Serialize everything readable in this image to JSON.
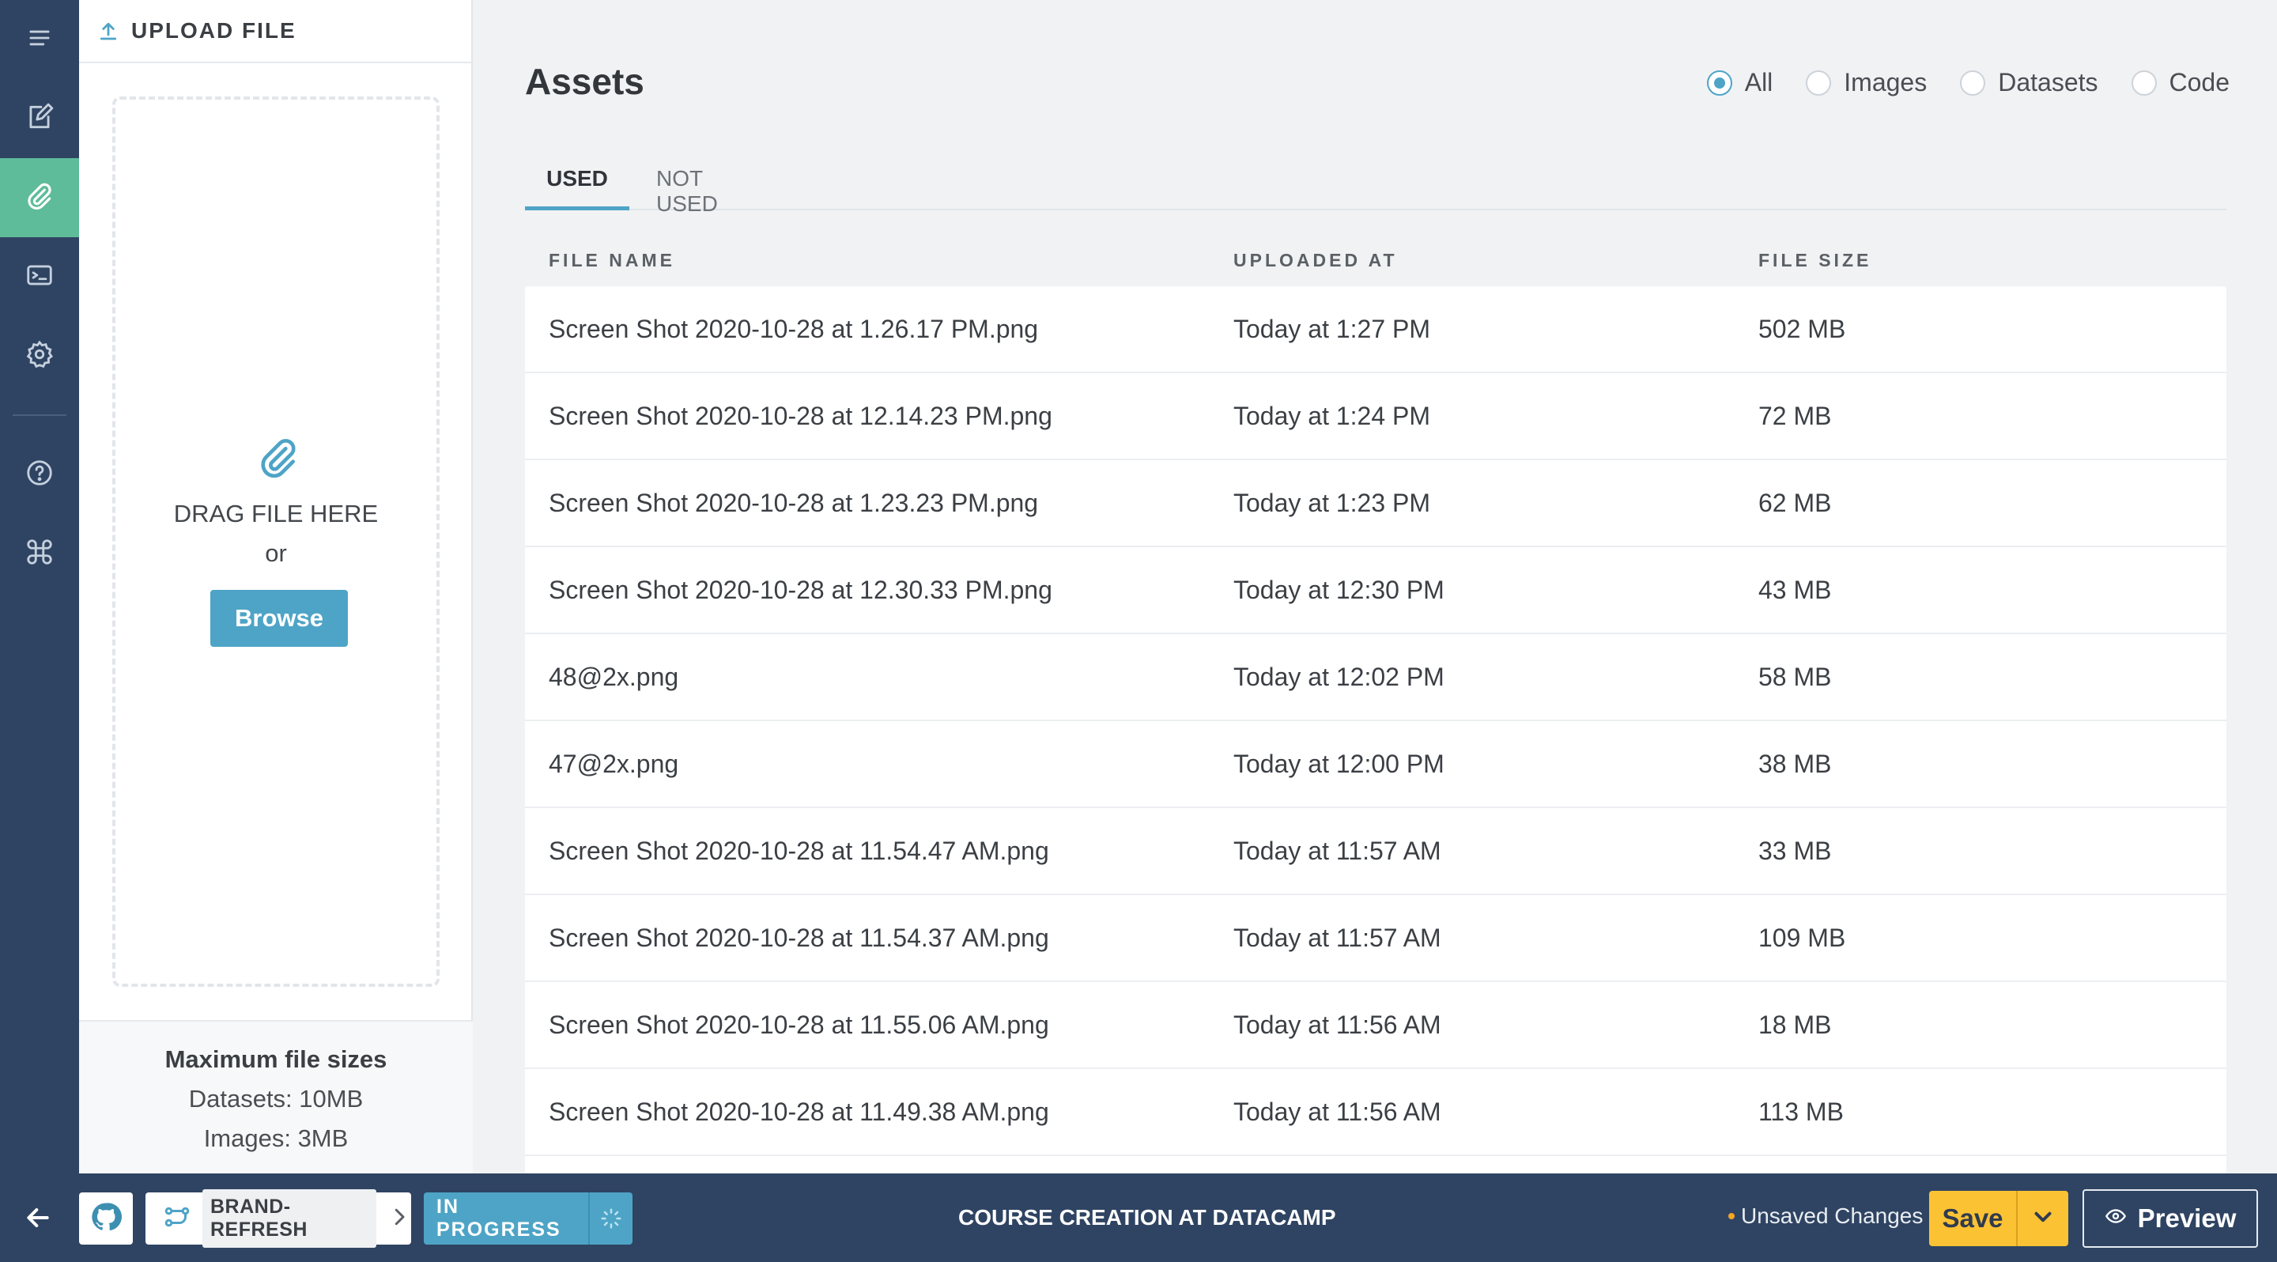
{
  "rail": {
    "items": [
      "menu-icon",
      "edit-icon",
      "paperclip-icon",
      "console-icon",
      "gear-icon",
      "help-icon",
      "command-icon"
    ],
    "active": "paperclip-icon"
  },
  "upload": {
    "title": "UPLOAD FILE",
    "drag_text": "DRAG FILE HERE",
    "or_text": "or",
    "browse_label": "Browse",
    "limits_title": "Maximum file sizes",
    "limit_datasets": "Datasets: 10MB",
    "limit_images": "Images: 3MB"
  },
  "main": {
    "title": "Assets",
    "filters": [
      {
        "label": "All",
        "checked": true
      },
      {
        "label": "Images",
        "checked": false
      },
      {
        "label": "Datasets",
        "checked": false
      },
      {
        "label": "Code",
        "checked": false
      }
    ],
    "tabs": [
      {
        "label": "USED",
        "active": true
      },
      {
        "label": "NOT USED",
        "active": false
      }
    ],
    "columns": [
      "FILE NAME",
      "UPLOADED AT",
      "FILE SIZE"
    ],
    "rows": [
      [
        "Screen Shot 2020-10-28 at 1.26.17 PM.png",
        "Today at 1:27 PM",
        "502 MB"
      ],
      [
        "Screen Shot 2020-10-28 at 12.14.23 PM.png",
        "Today at 1:24 PM",
        "72 MB"
      ],
      [
        "Screen Shot 2020-10-28 at 1.23.23 PM.png",
        "Today at 1:23 PM",
        "62 MB"
      ],
      [
        "Screen Shot 2020-10-28 at 12.30.33 PM.png",
        "Today at 12:30 PM",
        "43 MB"
      ],
      [
        "48@2x.png",
        "Today at 12:02 PM",
        "58 MB"
      ],
      [
        "47@2x.png",
        "Today at 12:00 PM",
        "38 MB"
      ],
      [
        "Screen Shot 2020-10-28 at 11.54.47 AM.png",
        "Today at 11:57 AM",
        "33 MB"
      ],
      [
        "Screen Shot 2020-10-28 at 11.54.37 AM.png",
        "Today at 11:57 AM",
        "109 MB"
      ],
      [
        "Screen Shot 2020-10-28 at 11.55.06 AM.png",
        "Today at 11:56 AM",
        "18 MB"
      ],
      [
        "Screen Shot 2020-10-28 at 11.49.38 AM.png",
        "Today at 11:56 AM",
        "113 MB"
      ]
    ]
  },
  "bottombar": {
    "branch": "BRAND-REFRESH",
    "status": "IN PROGRESS",
    "course_title": "COURSE CREATION AT DATACAMP",
    "unsaved": "Unsaved Changes",
    "save_label": "Save",
    "preview_label": "Preview"
  },
  "colors": {
    "navy": "#2f4462",
    "accent_blue": "#4ea4c6",
    "active_green": "#5ebc9b",
    "save_yellow": "#fbc234"
  }
}
